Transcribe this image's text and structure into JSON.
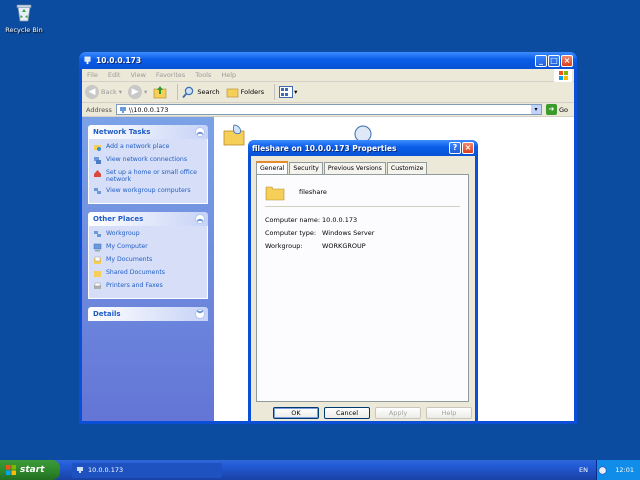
{
  "desktop": {
    "recycle_bin": "Recycle Bin"
  },
  "window": {
    "title": "10.0.0.173",
    "menu": [
      "File",
      "Edit",
      "View",
      "Favorites",
      "Tools",
      "Help"
    ],
    "toolbar": {
      "back": "Back",
      "search": "Search",
      "folders": "Folders"
    },
    "address": {
      "label": "Address",
      "value": "\\\\10.0.0.173",
      "go": "Go"
    },
    "taskpane": {
      "network_tasks": {
        "title": "Network Tasks",
        "items": [
          "Add a network place",
          "View network connections",
          "Set up a home or small office network",
          "View workgroup computers"
        ]
      },
      "other_places": {
        "title": "Other Places",
        "items": [
          "Workgroup",
          "My Computer",
          "My Documents",
          "Shared Documents",
          "Printers and Faxes"
        ]
      },
      "details": {
        "title": "Details"
      }
    }
  },
  "dialog": {
    "title": "fileshare on 10.0.0.173 Properties",
    "tabs": [
      "General",
      "Security",
      "Previous Versions",
      "Customize"
    ],
    "share_name": "fileshare",
    "props": [
      {
        "key": "Computer name:",
        "value": "10.0.0.173"
      },
      {
        "key": "Computer type:",
        "value": "Windows Server"
      },
      {
        "key": "Workgroup:",
        "value": "WORKGROUP"
      }
    ],
    "buttons": {
      "ok": "OK",
      "cancel": "Cancel",
      "apply": "Apply",
      "help": "Help"
    }
  },
  "taskbar": {
    "start": "start",
    "task": "10.0.0.173",
    "lang": "EN",
    "clock": "12:01"
  }
}
